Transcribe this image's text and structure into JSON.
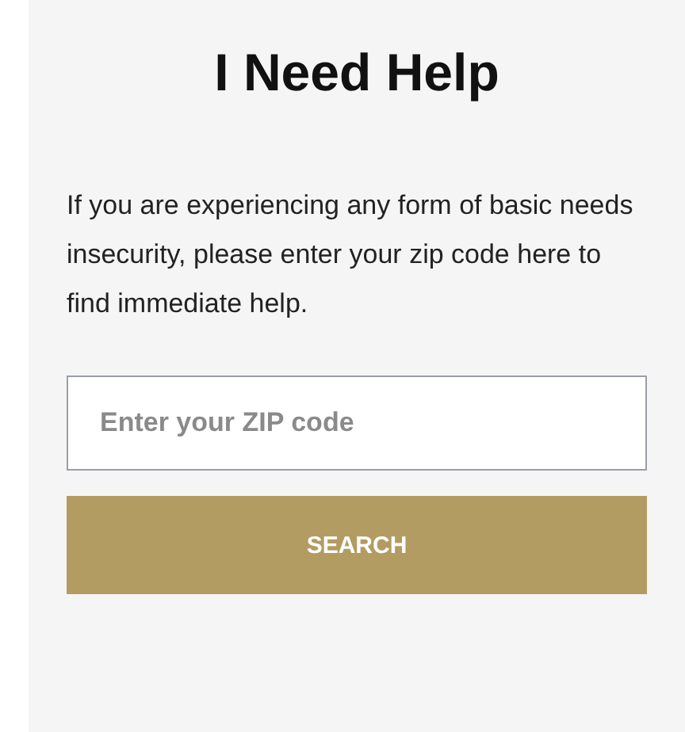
{
  "title": "I Need Help",
  "description": "If you are experiencing any form of basic needs insecurity, please enter your zip code here to find immediate help.",
  "zip_field": {
    "placeholder": "Enter your ZIP code"
  },
  "search_button": {
    "label": "SEARCH"
  }
}
